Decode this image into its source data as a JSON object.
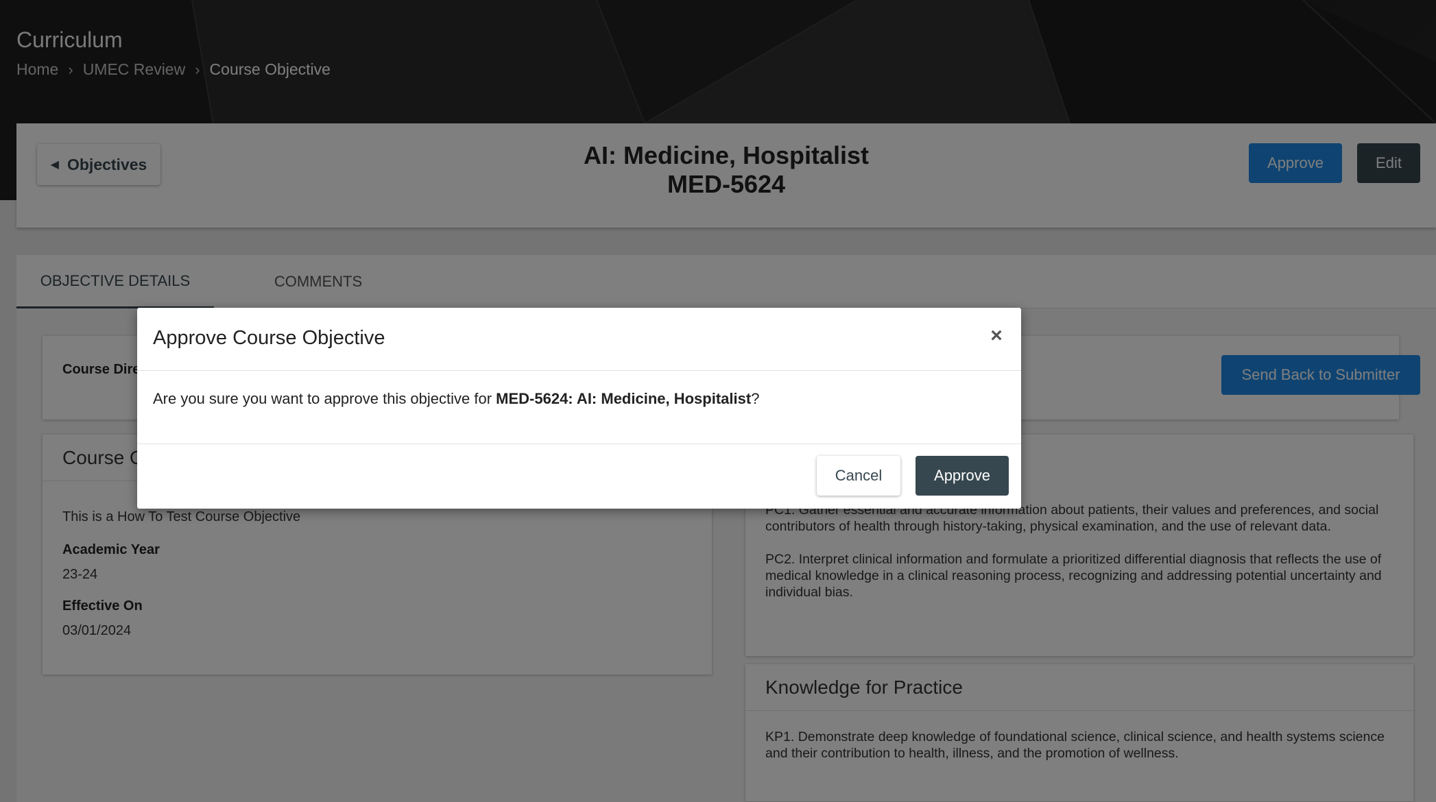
{
  "header": {
    "title": "Curriculum",
    "breadcrumb": [
      "Home",
      "UMEC Review",
      "Course Objective"
    ]
  },
  "top_card": {
    "back_label": "Objectives",
    "title_line1": "AI: Medicine, Hospitalist",
    "title_line2": "MED-5624",
    "approve_label": "Approve",
    "edit_label": "Edit"
  },
  "tabs": [
    {
      "label": "OBJECTIVE DETAILS",
      "active": true
    },
    {
      "label": "COMMENTS",
      "active": false
    }
  ],
  "director_card": {
    "label": "Course Dire",
    "send_back_label": "Send Back to Submitter"
  },
  "objective_card": {
    "title": "Course O",
    "description": "This is a How To Test Course Objective",
    "academic_year_label": "Academic Year",
    "academic_year": "23-24",
    "effective_on_label": "Effective On",
    "effective_on": "03/01/2024"
  },
  "competency_card": {
    "items": [
      "PC1. Gather essential and accurate information about patients, their values and preferences, and social contributors of health through history-taking, physical examination, and the use of relevant data.",
      "PC2. Interpret clinical information and formulate a prioritized differential diagnosis that reflects the use of medical knowledge in a clinical reasoning process, recognizing and addressing potential uncertainty and individual bias."
    ]
  },
  "knowledge_card": {
    "title": "Knowledge for Practice",
    "text": "KP1. Demonstrate deep knowledge of foundational science, clinical science, and health systems science and their contribution to health, illness, and the promotion of wellness."
  },
  "modal": {
    "title": "Approve Course Objective",
    "close_symbol": "×",
    "body_prefix": "Are you sure you want to approve this objective for ",
    "body_bold": "MED-5624: AI: Medicine, Hospitalist",
    "body_suffix": "?",
    "cancel_label": "Cancel",
    "approve_label": "Approve"
  },
  "icons": {
    "back": "caret-left-icon",
    "breadcrumb_separator": "chevron-right-icon",
    "close": "close-icon"
  },
  "colors": {
    "primary_blue": "#1e88e5",
    "dark_slate": "#37474f"
  }
}
